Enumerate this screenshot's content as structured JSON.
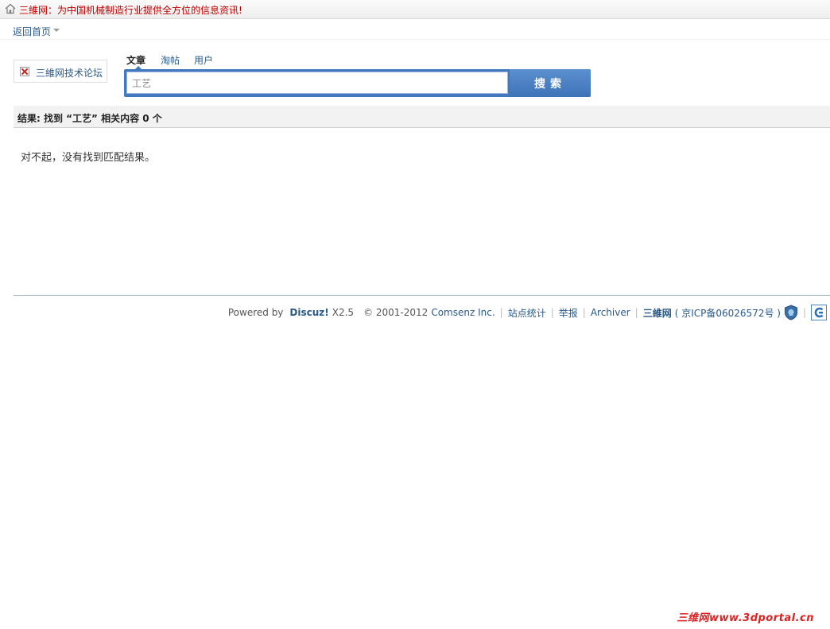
{
  "topbar": {
    "notice": "三維网：为中国机械制造行业提供全方位的信息资讯!",
    "home_icon": "home-icon"
  },
  "nav": {
    "home_link": "返回首页"
  },
  "logo": {
    "alt_text": "三維网技术论坛",
    "icon": "broken-image-icon"
  },
  "search": {
    "tabs": [
      {
        "label": "文章",
        "active": true
      },
      {
        "label": "淘帖",
        "active": false
      },
      {
        "label": "用户",
        "active": false
      }
    ],
    "query": "工艺",
    "button_label": "搜索"
  },
  "results": {
    "summary": "结果: 找到 “工艺” 相关内容 0 个",
    "empty_message": "对不起，没有找到匹配结果。"
  },
  "footer": {
    "powered_prefix": "Powered by",
    "brand": "Discuz!",
    "version": "X2.5",
    "copyright_prefix": "© 2001-2012",
    "company": "Comsenz Inc.",
    "links": [
      "站点统计",
      "举报",
      "Archiver"
    ],
    "site_name": "三維网",
    "icp": "( 京ICP备06026572号 )"
  },
  "watermark": "三维网www.3dportal.cn",
  "colors": {
    "accent": "#4178be",
    "notice_red": "#c00000",
    "link_blue": "#2a5a8a"
  }
}
